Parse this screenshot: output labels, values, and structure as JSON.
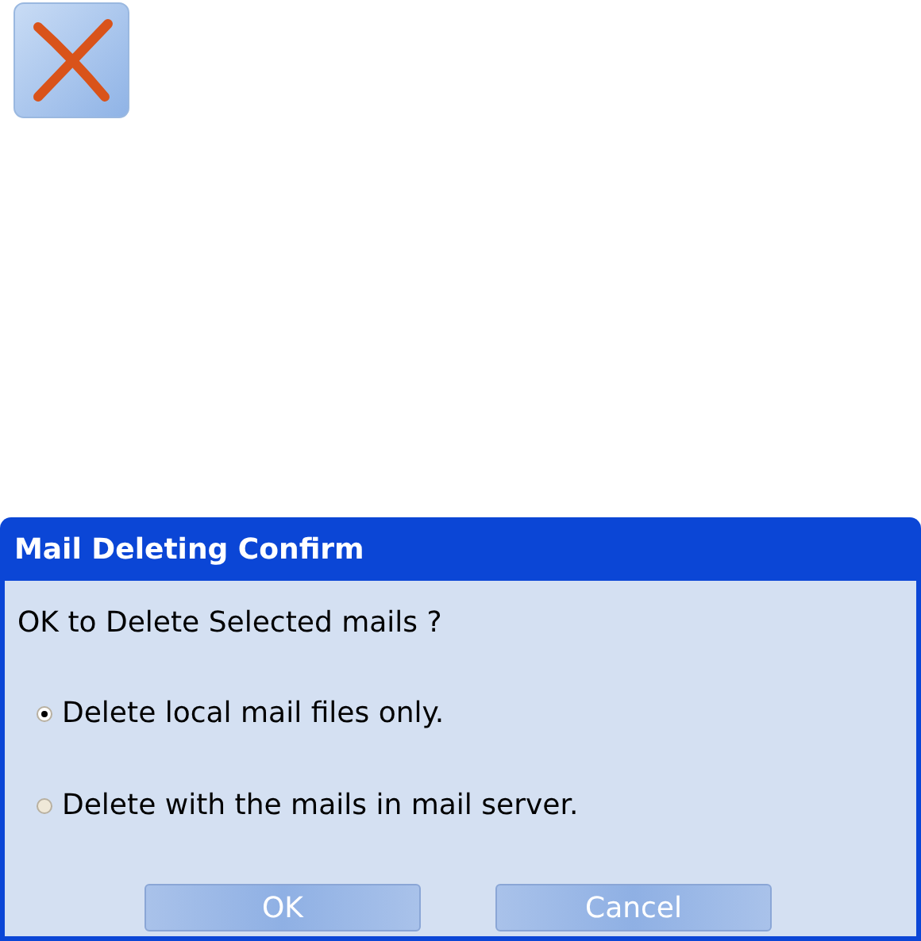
{
  "dialog": {
    "title": "Mail Deleting Confirm",
    "question": "OK to Delete Selected mails ?",
    "options": [
      {
        "label": "Delete local mail files only.",
        "selected": true
      },
      {
        "label": "Delete with the mails in mail server.",
        "selected": false
      }
    ],
    "buttons": [
      "OK",
      "Cancel"
    ]
  }
}
